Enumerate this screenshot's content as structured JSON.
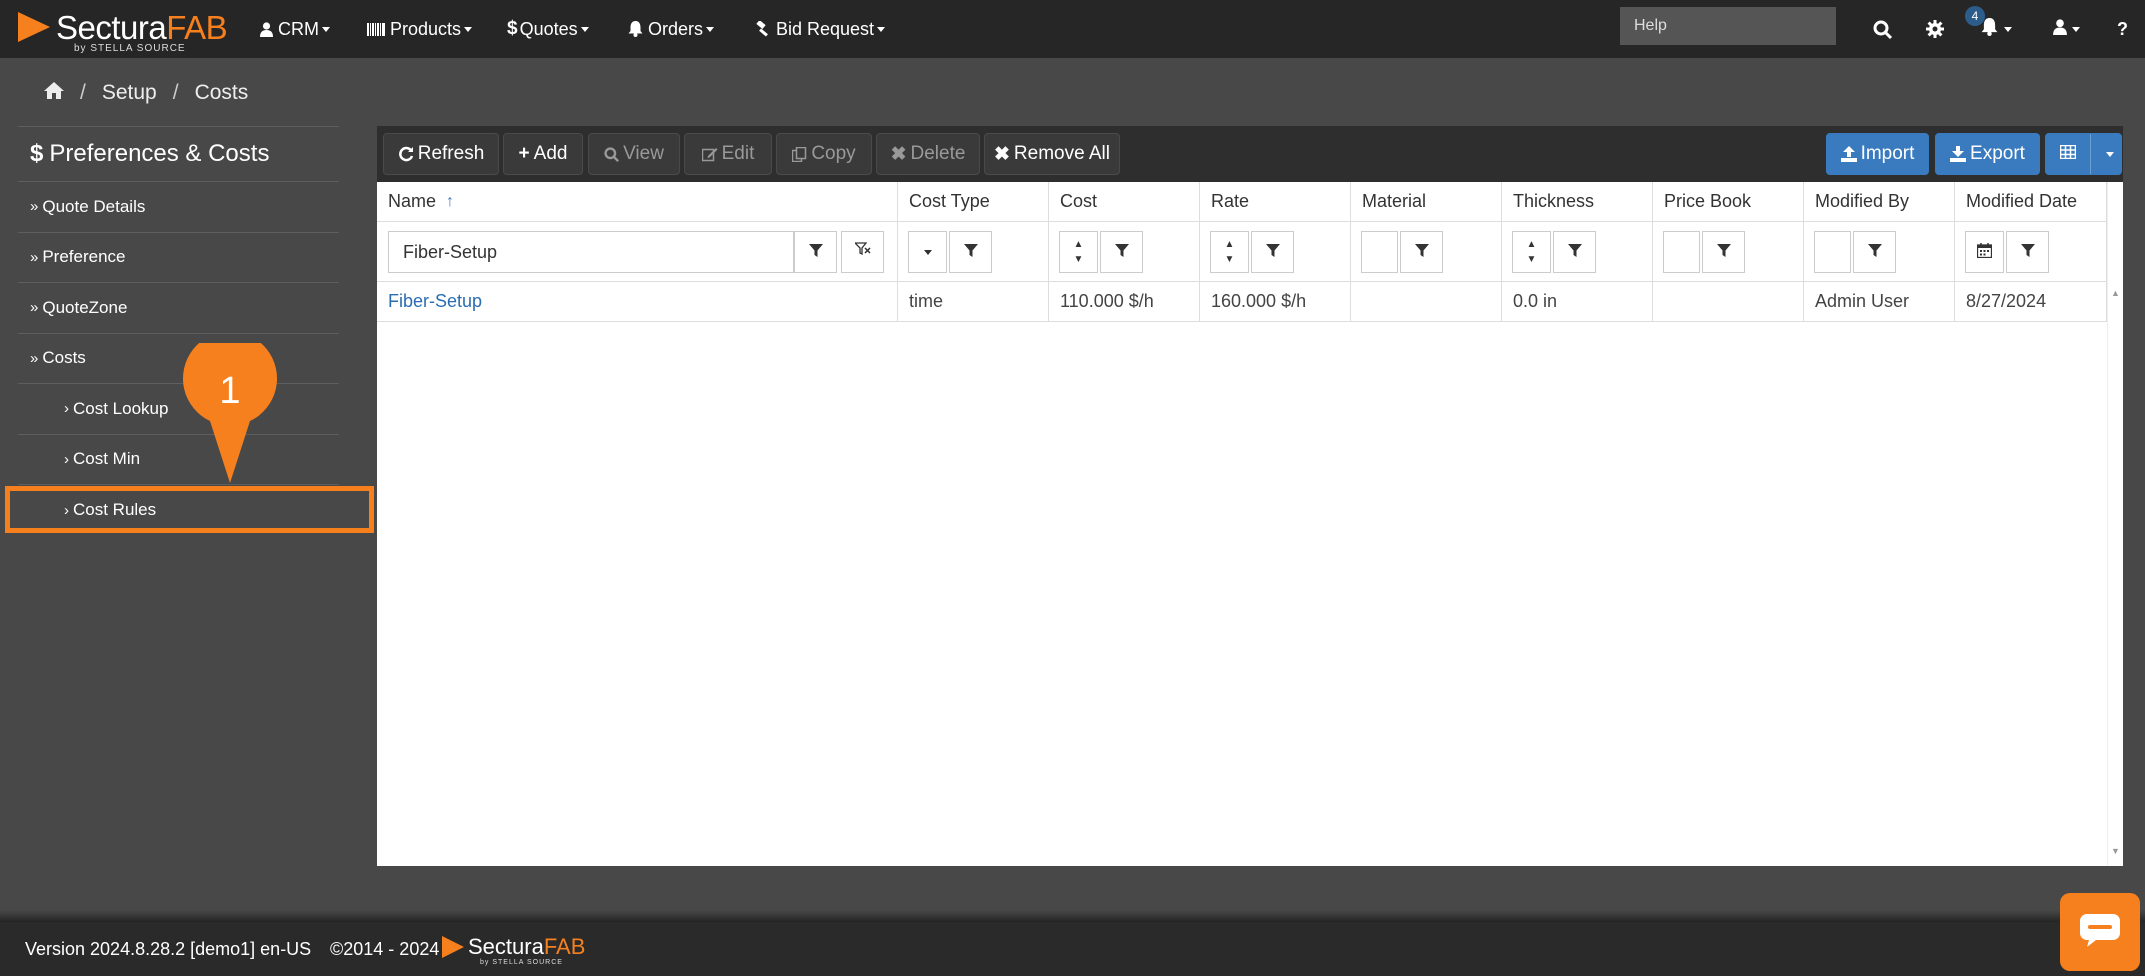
{
  "brand": {
    "name_part1": "Sectura",
    "name_part2": "FAB",
    "tagline": "by STELLA SOURCE"
  },
  "nav": {
    "items": [
      {
        "label": "CRM",
        "icon": "user-icon"
      },
      {
        "label": "Products",
        "icon": "barcode-icon"
      },
      {
        "label": "Quotes",
        "icon": "dollar-icon"
      },
      {
        "label": "Orders",
        "icon": "bell-icon"
      },
      {
        "label": "Bid Request",
        "icon": "gavel-icon"
      }
    ],
    "help_placeholder": "Help",
    "notification_count": "4"
  },
  "breadcrumb": {
    "home_icon": "home-icon",
    "items": [
      "Setup",
      "Costs"
    ]
  },
  "sidebar": {
    "title_symbol": "$",
    "title": "Preferences & Costs",
    "items": [
      "Quote Details",
      "Preference",
      "QuoteZone",
      "Costs"
    ],
    "subitems": [
      "Cost Lookup",
      "Cost Min",
      "Cost Rules"
    ],
    "active_subitem": "Cost Rules"
  },
  "annotation": {
    "step": "1",
    "color": "#f7801e"
  },
  "toolbar": {
    "refresh": "Refresh",
    "add": "Add",
    "view": "View",
    "edit": "Edit",
    "copy": "Copy",
    "delete": "Delete",
    "remove_all": "Remove All",
    "import": "Import",
    "export": "Export"
  },
  "grid": {
    "columns": [
      "Name",
      "Cost Type",
      "Cost",
      "Rate",
      "Material",
      "Thickness",
      "Price Book",
      "Modified By",
      "Modified Date"
    ],
    "name_filter_value": "Fiber-Setup",
    "rows": [
      [
        "Fiber-Setup",
        "time",
        "110.000 $/h",
        "160.000 $/h",
        "",
        "0.0 in",
        "",
        "Admin User",
        "8/27/2024"
      ]
    ]
  },
  "footer": {
    "version": "Version 2024.8.28.2 [demo1] en-US",
    "copyright": "©2014 - 2024",
    "logo_part1": "Sectura",
    "logo_part2": "FAB",
    "logo_tagline": "by STELLA SOURCE"
  },
  "colors": {
    "accent": "#f7801e",
    "primary_button": "#3a7bbf",
    "nav_bg": "#262626",
    "page_bg": "#484848",
    "link": "#2a6db1"
  }
}
